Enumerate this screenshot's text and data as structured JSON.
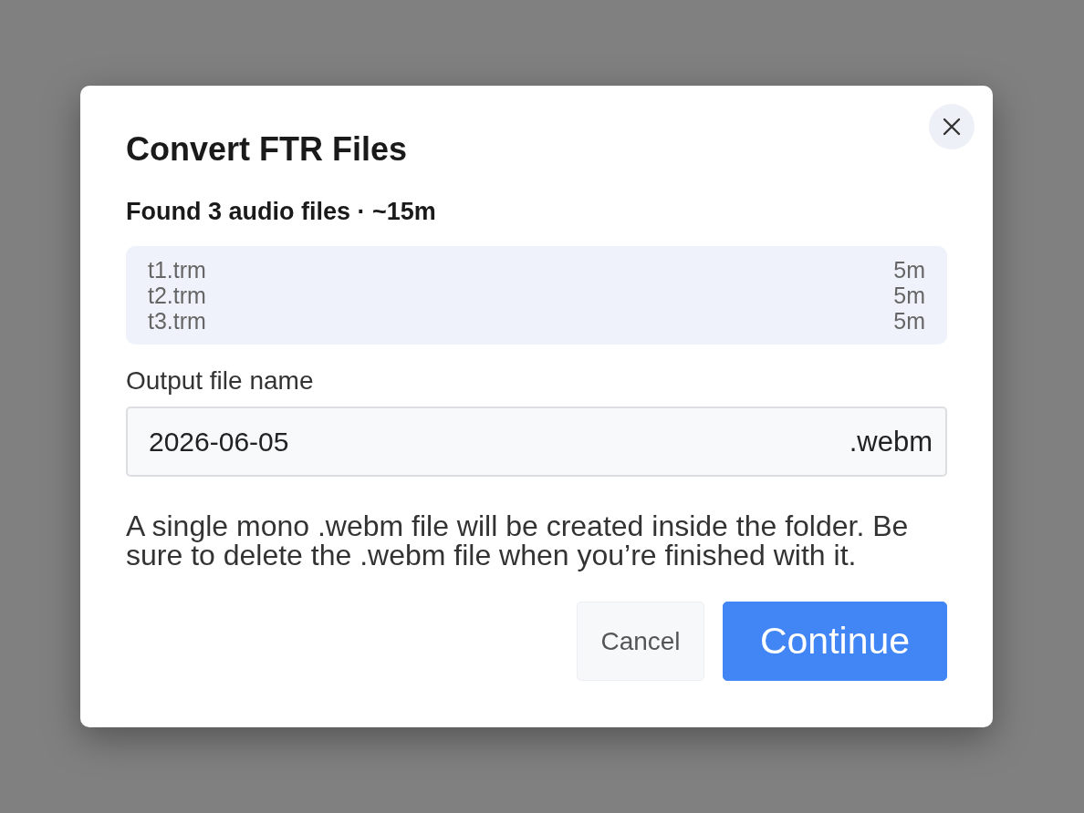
{
  "dialog": {
    "title": "Convert FTR Files",
    "summary": "Found 3 audio files · ~15m",
    "files": [
      {
        "name": "t1.trm",
        "duration": "5m"
      },
      {
        "name": "t2.trm",
        "duration": "5m"
      },
      {
        "name": "t3.trm",
        "duration": "5m"
      }
    ],
    "output": {
      "label": "Output file name",
      "value": "2026-06-05",
      "suffix": ".webm"
    },
    "note": "A single mono .webm file will be created inside the folder. Be sure to delete the .webm file when you’re finished with it.",
    "buttons": [
      {
        "label": "Cancel",
        "kind": "secondary"
      },
      {
        "label": "Continue",
        "kind": "primary"
      }
    ]
  }
}
